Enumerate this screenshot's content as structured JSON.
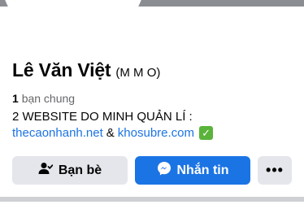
{
  "profile": {
    "name": "Lê Văn Việt",
    "alternate_name": "(M M O)",
    "friends_count": "1",
    "friends_label": "bạn chung",
    "bio_line1": "2 WEBSITE DO MINH QUẢN LÍ :",
    "link1": "thecaonhanh.net",
    "separator": "&",
    "link2": "khosubre.com"
  },
  "actions": {
    "friends_label": "Bạn bè",
    "message_label": "Nhắn tin",
    "more_label": "•••"
  },
  "icons": {
    "friends_icon": "person-check-icon",
    "messenger_icon": "messenger-icon",
    "check_icon": "green-check-icon"
  },
  "colors": {
    "accent": "#1b74e4",
    "secondary_button": "#e4e6eb",
    "check": "#5ab33a"
  }
}
